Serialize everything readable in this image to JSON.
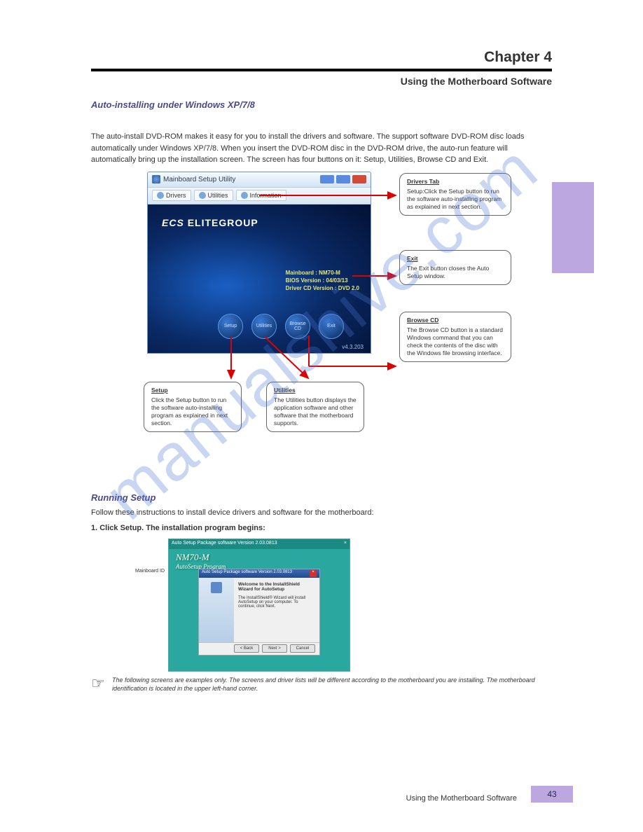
{
  "chapter": {
    "title": "Chapter 4",
    "subtitle": "Using the Motherboard Software",
    "intro1_title": "Auto-installing under Windows XP/7/8",
    "intro1": "The auto-install DVD-ROM makes it easy for you to install the drivers and software. The support software DVD-ROM disc loads automatically under Windows XP/7/8. When you insert the DVD-ROM disc in the DVD-ROM drive, the auto-run feature will automatically bring up the installation screen. The screen has four buttons on it: Setup, Utilities, Browse CD and Exit."
  },
  "app": {
    "window_title": "Mainboard Setup Utility",
    "toolbar": {
      "drivers": "Drivers",
      "utilities": "Utilities",
      "information": "Information"
    },
    "logo": {
      "brand": "ECS",
      "name": "ELITEGROUP"
    },
    "info": {
      "line1": "Mainboard : NM70-M",
      "line2": "BIOS Version : 04/03/13",
      "line3": "Driver CD Version : DVD 2.0"
    },
    "buttons": {
      "setup": "Setup",
      "utilities": "Utilities",
      "browse": "Browse CD",
      "exit": "Exit"
    },
    "version": "v4.3.203"
  },
  "callouts": {
    "c1t": "Drivers Tab",
    "c1": "Setup:Click the Setup button to run the software auto-installing program as explained in next section.",
    "c2t": "Exit",
    "c2": "The Exit button closes the Auto Setup window.",
    "c3t": "Browse CD",
    "c3": "The Browse CD button is a standard Windows command that you can check the contents of the disc with the Windows file browsing interface.",
    "c4t": "Setup",
    "c4": "Click the Setup button to run the software auto-installing program as explained in next section.",
    "c5t": "Utilities",
    "c5": "The Utilities button displays the application software and other software that the motherboard supports."
  },
  "setup": {
    "heading": "Running Setup",
    "p1": "Follow these instructions to install device drivers and software for the motherboard:",
    "p2": "1. Click Setup. The installation program begins:",
    "mbid": "Mainboard ID",
    "tbar": "Auto Setup Package software Version 2.03.0813",
    "brand": "NM70-M",
    "brandsub": "AutoSetup Program",
    "itbar": "Auto Setup Package software Version 2.03.0813",
    "iwelcome": "Welcome to the InstallShield Wizard for AutoSetup",
    "ibody": "The InstallShield® Wizard will install AutoSetup on your computer. To continue, click Next.",
    "btn_back": "< Back",
    "btn_next": "Next >",
    "btn_cancel": "Cancel",
    "note": "The following screens are examples only. The screens and driver lists will be different according to the motherboard you are installing.\n\nThe motherboard identification is located in the upper left-hand corner."
  },
  "footer": {
    "label": "Using the Motherboard Software",
    "page": "43"
  },
  "watermark": "manualshive.com"
}
